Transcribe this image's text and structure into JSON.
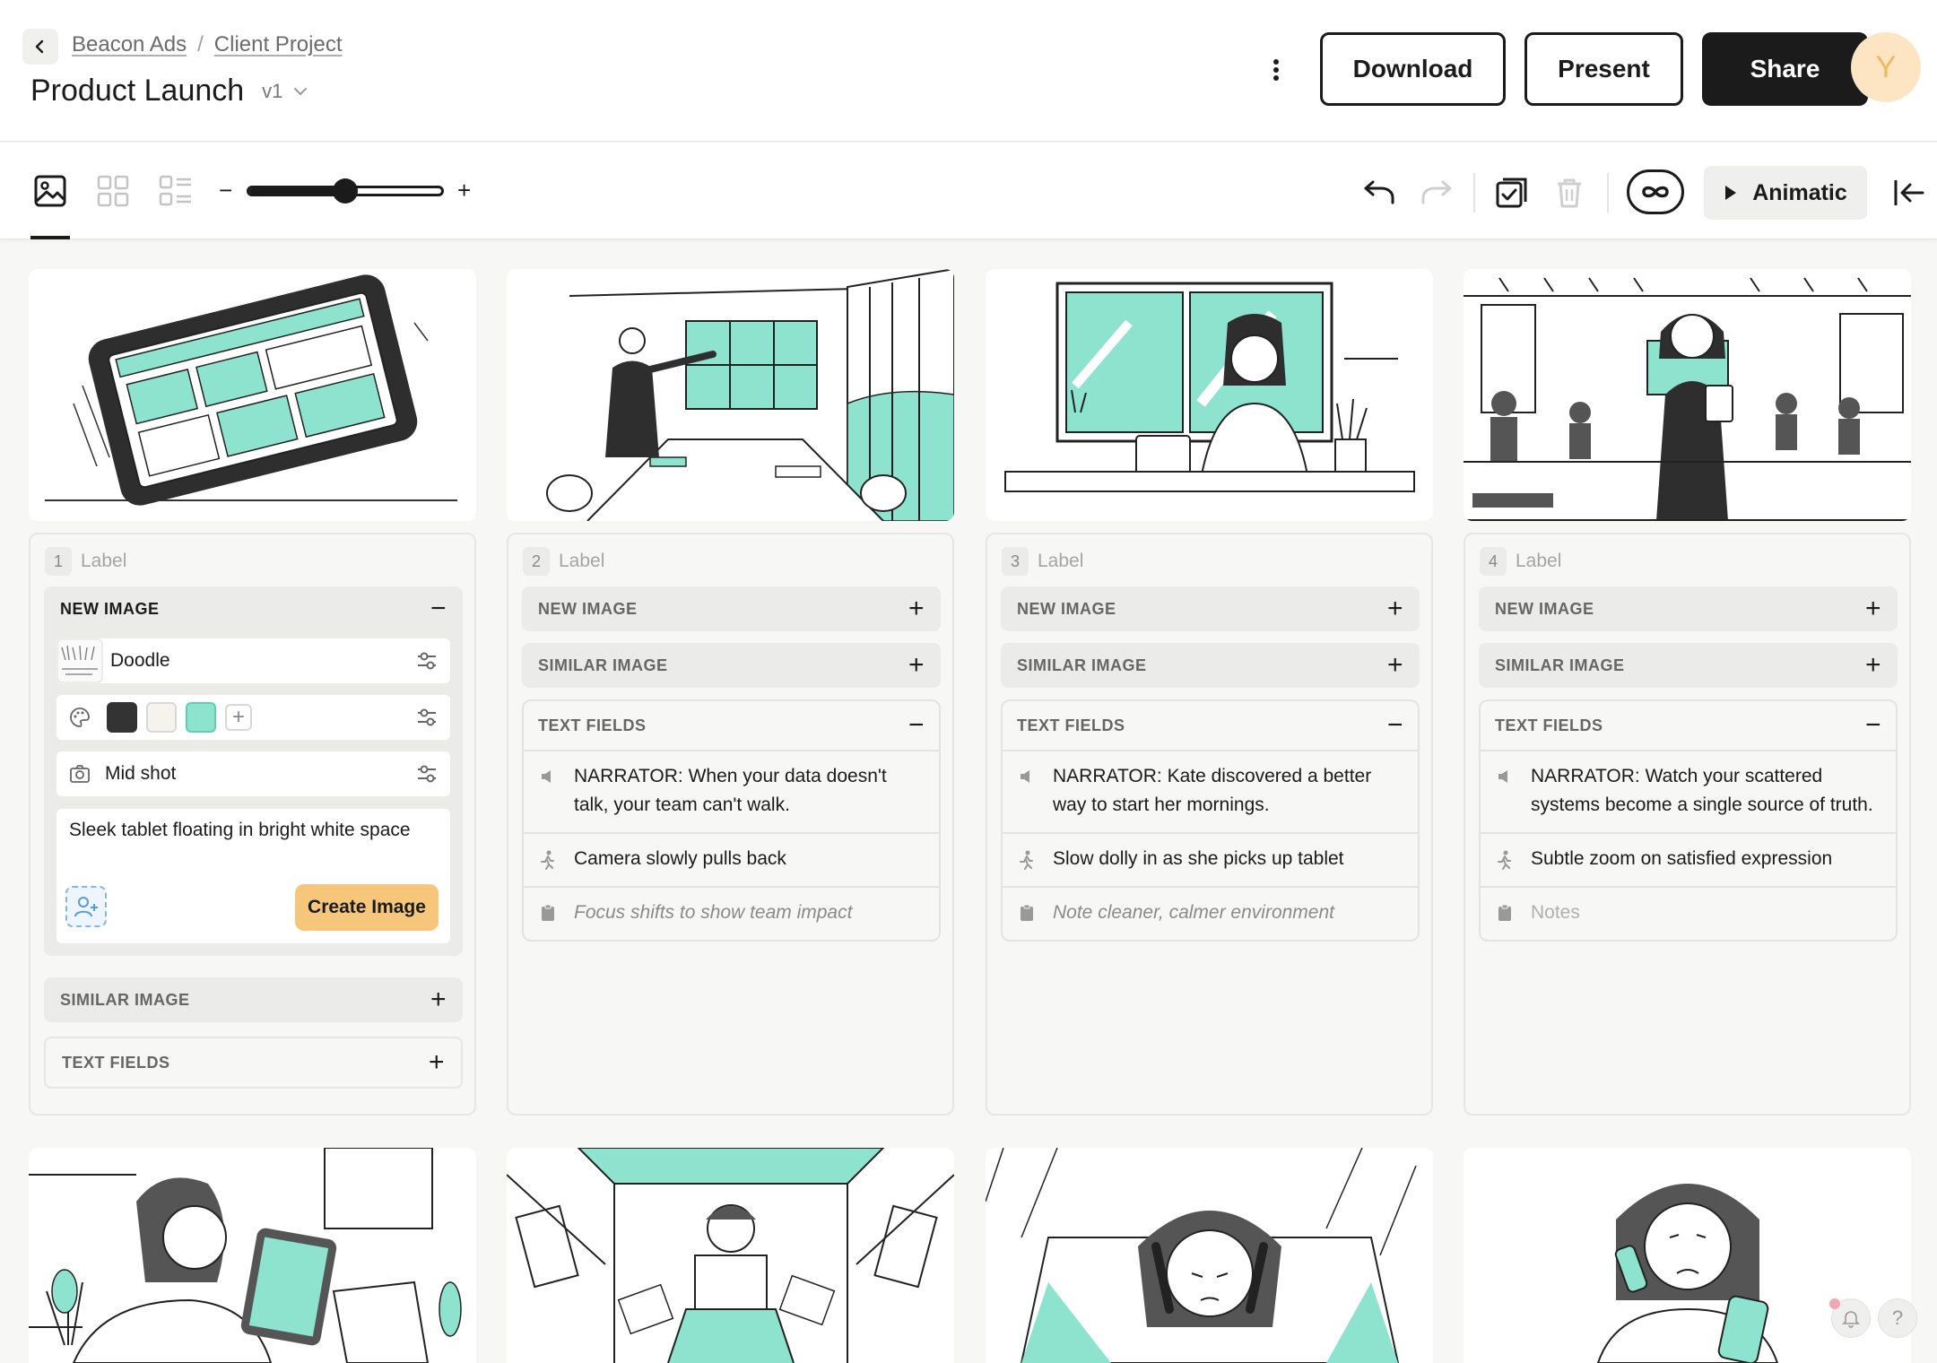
{
  "header": {
    "breadcrumb": [
      "Beacon Ads",
      "Client Project"
    ],
    "breadcrumb_sep": "/",
    "title": "Product Launch",
    "version": "v1",
    "download_label": "Download",
    "present_label": "Present",
    "share_label": "Share",
    "avatar_initial": "Y"
  },
  "toolbar": {
    "zoom_minus": "−",
    "zoom_plus": "+",
    "zoom_level": 0.5,
    "animatic_label": "Animatic"
  },
  "colors": {
    "accent_teal": "#8ee3cf",
    "dark_swatch": "#333333",
    "cream_swatch": "#f5f4ec",
    "create_button": "#f6c77a",
    "share_button": "#1b1b1b"
  },
  "card1": {
    "number": "1",
    "label": "Label",
    "new_image": "NEW IMAGE",
    "style": "Doodle",
    "shot": "Mid shot",
    "prompt": "Sleek tablet floating in bright white space",
    "create_label": "Create Image",
    "similar_image": "SIMILAR IMAGE",
    "text_fields": "TEXT FIELDS"
  },
  "cards": [
    {
      "number": "2",
      "label": "Label",
      "new_image": "NEW IMAGE",
      "similar_image": "SIMILAR IMAGE",
      "text_fields": "TEXT FIELDS",
      "narrator": "NARRATOR: When your data doesn't talk, your team can't walk.",
      "camera": "Camera slowly pulls back",
      "notes": "Focus shifts to show team impact"
    },
    {
      "number": "3",
      "label": "Label",
      "new_image": "NEW IMAGE",
      "similar_image": "SIMILAR IMAGE",
      "text_fields": "TEXT FIELDS",
      "narrator": "NARRATOR: Kate discovered a better way to start her mornings.",
      "camera": "Slow dolly in as she picks up tablet",
      "notes": "Note cleaner, calmer environment"
    },
    {
      "number": "4",
      "label": "Label",
      "new_image": "NEW IMAGE",
      "similar_image": "SIMILAR IMAGE",
      "text_fields": "TEXT FIELDS",
      "narrator": "NARRATOR: Watch your scattered systems become a single source of truth.",
      "camera": "Subtle zoom on satisfied expression",
      "notes_placeholder": "Notes"
    }
  ],
  "help_label": "?"
}
